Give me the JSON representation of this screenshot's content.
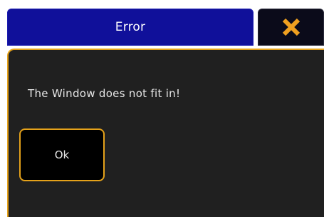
{
  "dialog": {
    "title": "Error",
    "close_icon": "close-x-icon",
    "message": "The Window does not fit in!",
    "ok_label": "Ok"
  },
  "colors": {
    "title_bar": "#10109a",
    "accent": "#e5a21a",
    "panel": "#202020",
    "close_bg": "#0b0b1a"
  }
}
